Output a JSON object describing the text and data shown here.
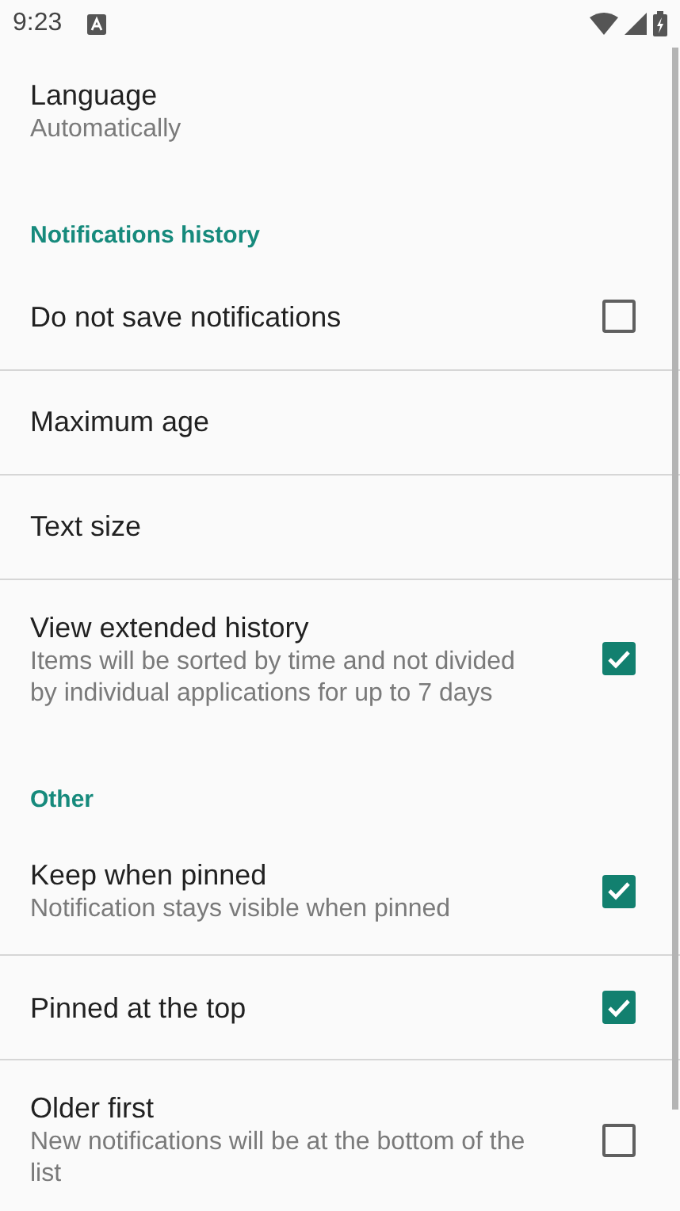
{
  "status_bar": {
    "time": "9:23"
  },
  "sections": [
    {
      "items": [
        {
          "title": "Language",
          "summary": "Automatically"
        }
      ]
    },
    {
      "header": "Notifications history",
      "items": [
        {
          "title": "Do not save notifications",
          "kind": "checkbox",
          "checked": false
        },
        {
          "title": "Maximum age"
        },
        {
          "title": "Text size"
        },
        {
          "title": "View extended history",
          "summary": "Items will be sorted by time and not divided by individual applications for up to 7 days",
          "kind": "checkbox",
          "checked": true
        }
      ]
    },
    {
      "header": "Other",
      "items": [
        {
          "title": "Keep when pinned",
          "summary": "Notification stays visible when pinned",
          "kind": "checkbox",
          "checked": true
        },
        {
          "title": "Pinned at the top",
          "kind": "checkbox",
          "checked": true
        },
        {
          "title": "Older first",
          "summary": "New notifications will be at the bottom of the list",
          "kind": "checkbox",
          "checked": false
        }
      ]
    }
  ]
}
